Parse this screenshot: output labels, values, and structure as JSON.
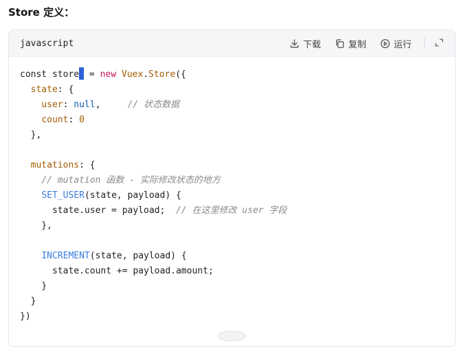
{
  "heading": "Store 定义：",
  "code_block": {
    "language": "javascript",
    "actions": {
      "download": "下载",
      "copy": "复制",
      "run": "运行"
    },
    "lines": [
      [
        {
          "t": "const store",
          "c": ""
        },
        {
          "cursor": true
        },
        {
          "t": " = ",
          "c": ""
        },
        {
          "t": "new",
          "c": "kw"
        },
        {
          "t": " ",
          "c": ""
        },
        {
          "t": "Vuex",
          "c": "cls"
        },
        {
          "t": ".",
          "c": ""
        },
        {
          "t": "Store",
          "c": "cls"
        },
        {
          "t": "({",
          "c": ""
        }
      ],
      [
        {
          "t": "  ",
          "c": ""
        },
        {
          "t": "state",
          "c": "prop"
        },
        {
          "t": ": {",
          "c": ""
        }
      ],
      [
        {
          "t": "    ",
          "c": ""
        },
        {
          "t": "user",
          "c": "prop"
        },
        {
          "t": ": ",
          "c": ""
        },
        {
          "t": "null",
          "c": "lit"
        },
        {
          "t": ",     ",
          "c": ""
        },
        {
          "t": "// 状态数据",
          "c": "cm"
        }
      ],
      [
        {
          "t": "    ",
          "c": ""
        },
        {
          "t": "count",
          "c": "prop"
        },
        {
          "t": ": ",
          "c": ""
        },
        {
          "t": "0",
          "c": "num"
        }
      ],
      [
        {
          "t": "  },",
          "c": ""
        }
      ],
      [
        {
          "t": "",
          "c": ""
        }
      ],
      [
        {
          "t": "  ",
          "c": ""
        },
        {
          "t": "mutations",
          "c": "prop"
        },
        {
          "t": ": {",
          "c": ""
        }
      ],
      [
        {
          "t": "    ",
          "c": ""
        },
        {
          "t": "// mutation 函数 - 实际修改状态的地方",
          "c": "cm"
        }
      ],
      [
        {
          "t": "    ",
          "c": ""
        },
        {
          "t": "SET_USER",
          "c": "fn"
        },
        {
          "t": "(state, payload) {",
          "c": ""
        }
      ],
      [
        {
          "t": "      state.user = payload;  ",
          "c": ""
        },
        {
          "t": "// 在这里修改 user 字段",
          "c": "cm"
        }
      ],
      [
        {
          "t": "    },",
          "c": ""
        }
      ],
      [
        {
          "t": "",
          "c": ""
        }
      ],
      [
        {
          "t": "    ",
          "c": ""
        },
        {
          "t": "INCREMENT",
          "c": "fn"
        },
        {
          "t": "(state, payload) {",
          "c": ""
        }
      ],
      [
        {
          "t": "      state.count += payload.amount;",
          "c": ""
        }
      ],
      [
        {
          "t": "    }",
          "c": ""
        }
      ],
      [
        {
          "t": "  }",
          "c": ""
        }
      ],
      [
        {
          "t": "})",
          "c": ""
        }
      ]
    ]
  },
  "icons": {
    "download": "download-icon",
    "copy": "copy-icon",
    "run": "play-circle-icon",
    "expand": "expand-icon"
  }
}
